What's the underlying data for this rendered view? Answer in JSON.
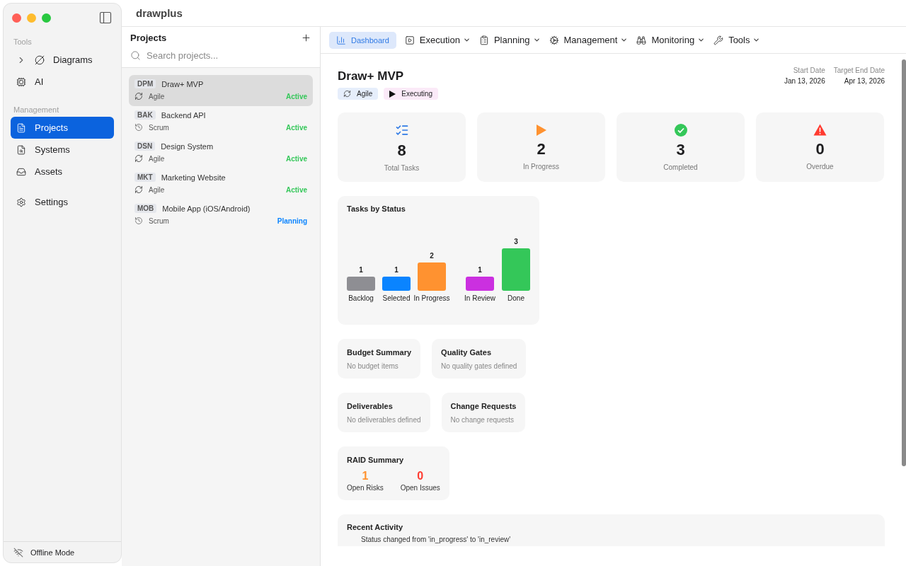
{
  "app_title": "drawplus",
  "sidebar": {
    "sections": [
      {
        "title": "Tools",
        "items": [
          {
            "label": "Diagrams",
            "kind": "group",
            "expanded": false,
            "selected": false
          },
          {
            "label": "AI",
            "kind": "link",
            "selected": false
          }
        ]
      },
      {
        "title": "Management",
        "items": [
          {
            "label": "Projects",
            "kind": "link",
            "selected": true
          },
          {
            "label": "Systems",
            "kind": "link",
            "selected": false
          },
          {
            "label": "Assets",
            "kind": "link",
            "selected": false
          }
        ]
      },
      {
        "items": [
          {
            "label": "Settings",
            "kind": "link",
            "selected": false
          }
        ]
      }
    ],
    "footer": "Offline Mode"
  },
  "projects": {
    "title": "Projects",
    "search_placeholder": "Search projects...",
    "items": [
      {
        "code": "DPM",
        "name": "Draw+ MVP",
        "method": "Agile",
        "status": "Active",
        "color": "#34c759",
        "selected": true
      },
      {
        "code": "BAK",
        "name": "Backend API",
        "method": "Scrum",
        "status": "Active",
        "color": "#34c759",
        "selected": false
      },
      {
        "code": "DSN",
        "name": "Design System",
        "method": "Agile",
        "status": "Active",
        "color": "#34c759",
        "selected": false
      },
      {
        "code": "MKT",
        "name": "Marketing Website",
        "method": "Agile",
        "status": "Active",
        "color": "#34c759",
        "selected": false
      },
      {
        "code": "MOB",
        "name": "Mobile App (iOS/Android)",
        "method": "Scrum",
        "status": "Planning",
        "color": "#0a84ff",
        "selected": false
      }
    ]
  },
  "nav_tabs": [
    {
      "label": "Dashboard",
      "selected": true
    },
    {
      "label": "Execution",
      "selected": false
    },
    {
      "label": "Planning",
      "selected": false
    },
    {
      "label": "Management",
      "selected": false
    },
    {
      "label": "Monitoring",
      "selected": false
    },
    {
      "label": "Tools",
      "selected": false
    }
  ],
  "project": {
    "title": "Draw+ MVP",
    "tags": [
      {
        "label": "Agile",
        "color": "#e6eefb"
      },
      {
        "label": "Executing",
        "color": "#fbeaf8"
      }
    ],
    "dates": [
      {
        "label": "Start Date",
        "value": "Jan 13, 2026"
      },
      {
        "label": "Target End Date",
        "value": "Apr 13, 2026"
      }
    ]
  },
  "stats": [
    {
      "value": "8",
      "label": "Total Tasks"
    },
    {
      "value": "2",
      "label": "In Progress"
    },
    {
      "value": "3",
      "label": "Completed"
    },
    {
      "value": "0",
      "label": "Overdue"
    }
  ],
  "tasks_chart": {
    "title": "Tasks by Status",
    "chart_data": {
      "type": "bar",
      "categories": [
        "Backlog",
        "Selected",
        "In Progress",
        "In Review",
        "Done"
      ],
      "values": [
        1,
        1,
        2,
        1,
        3
      ],
      "data_labels": true
    }
  },
  "card_rows": [
    [
      {
        "title": "Budget Summary",
        "message": "No budget items"
      },
      {
        "title": "Quality Gates",
        "message": "No quality gates defined"
      }
    ],
    [
      {
        "title": "Deliverables",
        "message": "No deliverables defined"
      },
      {
        "title": "Change Requests",
        "message": "No change requests"
      }
    ]
  ],
  "raid": {
    "title": "RAID Summary",
    "metrics": [
      {
        "value": "1",
        "label": "Open Risks",
        "color": "#ff9230"
      },
      {
        "value": "0",
        "label": "Open Issues",
        "color": "#ff3b30"
      }
    ]
  },
  "recent_activity": {
    "title": "Recent Activity",
    "entries": [
      "Status changed from 'in_progress' to 'in_review'"
    ]
  }
}
